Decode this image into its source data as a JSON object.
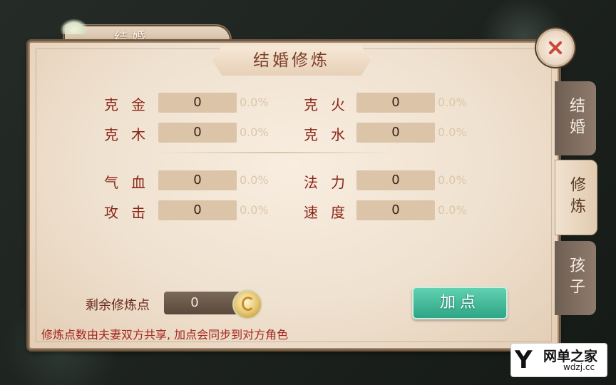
{
  "window": {
    "tab_title": "结婚",
    "header": "结婚修炼"
  },
  "stats": [
    {
      "label": "克金",
      "value": "0",
      "pct": "0.0%"
    },
    {
      "label": "克火",
      "value": "0",
      "pct": "0.0%"
    },
    {
      "label": "克木",
      "value": "0",
      "pct": "0.0%"
    },
    {
      "label": "克水",
      "value": "0",
      "pct": "0.0%"
    },
    {
      "label": "气血",
      "value": "0",
      "pct": "0.0%"
    },
    {
      "label": "法力",
      "value": "0",
      "pct": "0.0%"
    },
    {
      "label": "攻击",
      "value": "0",
      "pct": "0.0%"
    },
    {
      "label": "速度",
      "value": "0",
      "pct": "0.0%"
    }
  ],
  "points": {
    "label": "剩余修炼点",
    "value": "0"
  },
  "add_button_label": "加点",
  "note": "修炼点数由夫妻双方共享, 加点会同步到对方角色",
  "side_tabs": [
    {
      "label": "结婚",
      "active": false
    },
    {
      "label": "修炼",
      "active": true
    },
    {
      "label": "孩子",
      "active": false
    }
  ],
  "watermark": {
    "brand": "网单之家",
    "url": "wdzj.cc"
  },
  "colors": {
    "label_red": "#8a2418",
    "button_green": "#2ea586",
    "panel_bg": "#efe1cf"
  },
  "icons": {
    "close": "close-icon",
    "coin": "coin-icon"
  }
}
